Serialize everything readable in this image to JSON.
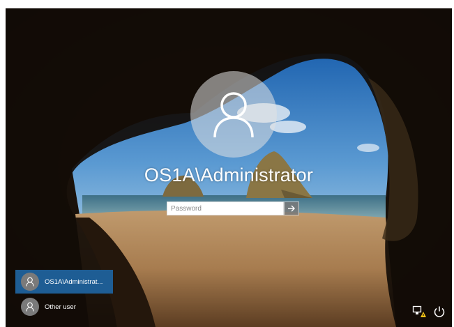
{
  "lock_screen": {
    "username": "OS1A\\Administrator",
    "password_placeholder": "Password"
  },
  "user_list": [
    {
      "label": "OS1A\\Administrat...",
      "selected": true
    },
    {
      "label": "Other user",
      "selected": false
    }
  ],
  "corner_icons": [
    "network-warning-icon",
    "power-icon"
  ],
  "colors": {
    "selected_user": "#1e5d94",
    "avatar_circle": "#e1e1e1",
    "submit_button": "#787878"
  }
}
